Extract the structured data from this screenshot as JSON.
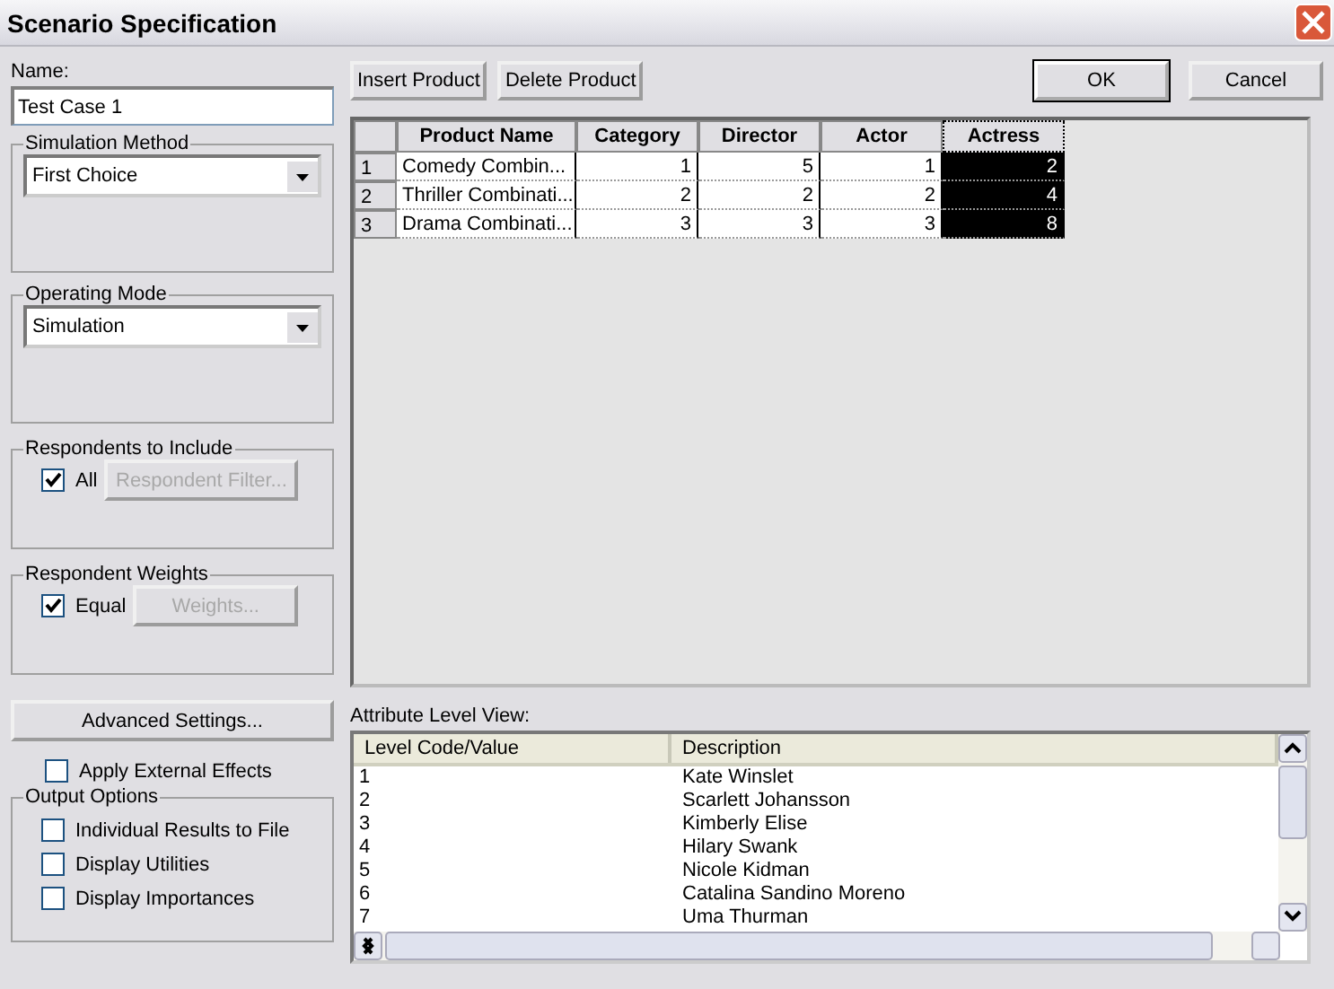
{
  "window": {
    "title": "Scenario Specification"
  },
  "name_field": {
    "label": "Name:",
    "value": "Test Case 1"
  },
  "simulation_method": {
    "title": "Simulation Method",
    "value": "First Choice"
  },
  "operating_mode": {
    "title": "Operating Mode",
    "value": "Simulation"
  },
  "respondents": {
    "title": "Respondents to Include",
    "checkbox": {
      "label": "All",
      "checked": true
    },
    "button": {
      "label": "Respondent Filter...",
      "disabled": true
    }
  },
  "weights": {
    "title": "Respondent Weights",
    "checkbox": {
      "label": "Equal",
      "checked": true
    },
    "button": {
      "label": "Weights...",
      "disabled": true
    }
  },
  "advanced_button": "Advanced Settings...",
  "apply_external": {
    "label": "Apply External Effects",
    "checked": false
  },
  "output_options": {
    "title": "Output Options",
    "items": [
      {
        "label": "Individual Results to File",
        "checked": false
      },
      {
        "label": "Display Utilities",
        "checked": false
      },
      {
        "label": "Display Importances",
        "checked": false
      }
    ]
  },
  "toolbar": [
    "Insert Product",
    "Delete Product"
  ],
  "dialog_buttons": [
    "OK",
    "Cancel"
  ],
  "products": {
    "columns": [
      {
        "label": "Product Name",
        "selected": false
      },
      {
        "label": "Category",
        "selected": false
      },
      {
        "label": "Director",
        "selected": false
      },
      {
        "label": "Actor",
        "selected": false
      },
      {
        "label": "Actress",
        "selected": true
      }
    ],
    "rows": [
      {
        "number": "1",
        "cells": [
          "Comedy Combin...",
          "1",
          "5",
          "1",
          "2"
        ]
      },
      {
        "number": "2",
        "cells": [
          "Thriller Combinati...",
          "2",
          "2",
          "2",
          "4"
        ]
      },
      {
        "number": "3",
        "cells": [
          "Drama Combinati...",
          "3",
          "3",
          "3",
          "8"
        ]
      }
    ]
  },
  "attribute_view": {
    "label": "Attribute Level View:",
    "columns": [
      "Level Code/Value",
      "Description"
    ],
    "rows": [
      [
        "1",
        "Kate Winslet"
      ],
      [
        "2",
        "Scarlett Johansson"
      ],
      [
        "3",
        "Kimberly Elise"
      ],
      [
        "4",
        "Hilary Swank"
      ],
      [
        "5",
        "Nicole Kidman"
      ],
      [
        "6",
        "Catalina Sandino Moreno"
      ],
      [
        "7",
        "Uma Thurman"
      ]
    ]
  }
}
